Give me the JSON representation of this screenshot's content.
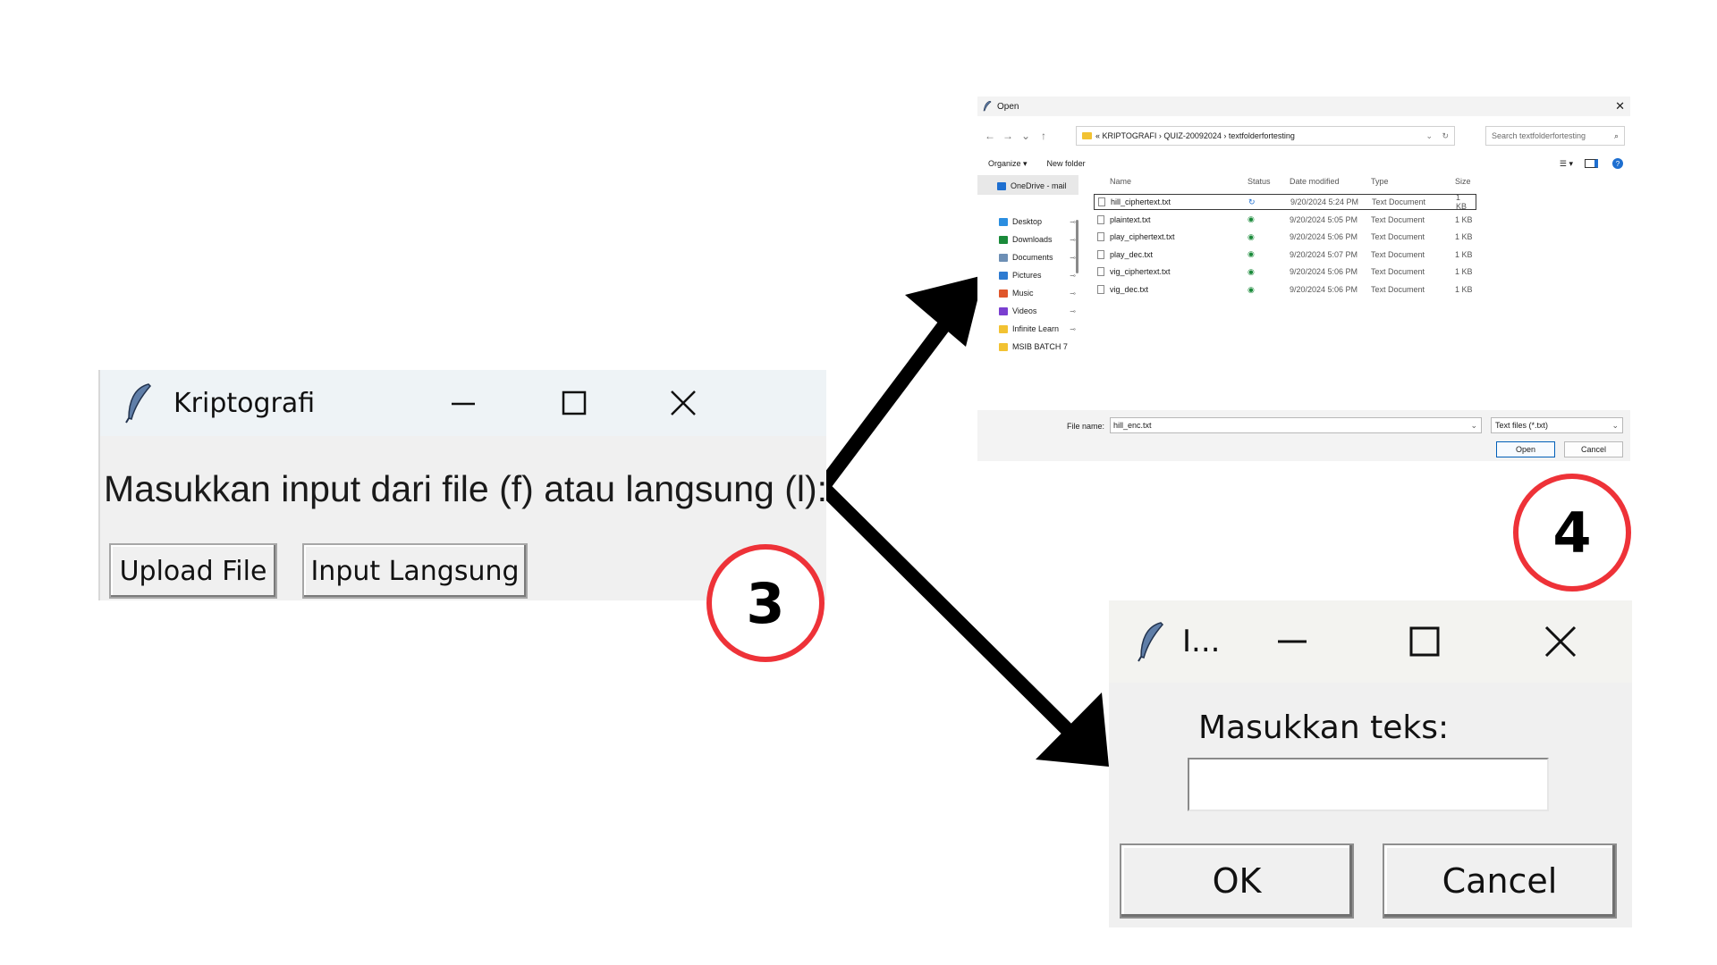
{
  "kriptografi_window": {
    "title": "Kriptografi",
    "prompt": "Masukkan input dari file (f) atau langsung (l):",
    "buttons": {
      "upload": "Upload File",
      "direct": "Input Langsung"
    }
  },
  "open_dialog": {
    "title": "Open",
    "breadcrumb": "« KRIPTOGRAFI  ›  QUIZ-20092024  ›  textfolderfortesting",
    "search_placeholder": "Search textfolderfortesting",
    "toolbar": {
      "organize": "Organize ▾",
      "new_folder": "New folder"
    },
    "sidebar": [
      {
        "label": "OneDrive - mail",
        "color": "#1e6fd0",
        "pinned": false
      },
      {
        "label": "Desktop",
        "color": "#2b8ee0",
        "pinned": true
      },
      {
        "label": "Downloads",
        "color": "#1a8a3a",
        "pinned": true
      },
      {
        "label": "Documents",
        "color": "#6d8fb5",
        "pinned": true
      },
      {
        "label": "Pictures",
        "color": "#2d7bd1",
        "pinned": true
      },
      {
        "label": "Music",
        "color": "#e0562b",
        "pinned": true
      },
      {
        "label": "Videos",
        "color": "#7a3fd0",
        "pinned": true
      },
      {
        "label": "Infinite Learn",
        "color": "#f2c232",
        "pinned": true
      },
      {
        "label": "MSIB BATCH 7",
        "color": "#f2c232",
        "pinned": false
      }
    ],
    "columns": {
      "name": "Name",
      "status": "Status",
      "date": "Date modified",
      "type": "Type",
      "size": "Size"
    },
    "files": [
      {
        "name": "hill_ciphertext.txt",
        "status": "syncing",
        "date": "9/20/2024 5:24 PM",
        "type": "Text Document",
        "size": "1 KB"
      },
      {
        "name": "plaintext.txt",
        "status": "synced",
        "date": "9/20/2024 5:05 PM",
        "type": "Text Document",
        "size": "1 KB"
      },
      {
        "name": "play_ciphertext.txt",
        "status": "synced",
        "date": "9/20/2024 5:06 PM",
        "type": "Text Document",
        "size": "1 KB"
      },
      {
        "name": "play_dec.txt",
        "status": "synced",
        "date": "9/20/2024 5:07 PM",
        "type": "Text Document",
        "size": "1 KB"
      },
      {
        "name": "vig_ciphertext.txt",
        "status": "synced",
        "date": "9/20/2024 5:06 PM",
        "type": "Text Document",
        "size": "1 KB"
      },
      {
        "name": "vig_dec.txt",
        "status": "synced",
        "date": "9/20/2024 5:06 PM",
        "type": "Text Document",
        "size": "1 KB"
      }
    ],
    "file_name_label": "File name:",
    "file_name_value": "hill_enc.txt",
    "file_type": "Text files (*.txt)",
    "open_button": "Open",
    "cancel_button": "Cancel"
  },
  "input_dialog": {
    "title": "I...",
    "label": "Masukkan teks:",
    "entry_value": "",
    "ok_button": "OK",
    "cancel_button": "Cancel"
  },
  "markers": {
    "step3": "3",
    "step4": "4"
  },
  "colors": {
    "marker_ring": "#ee3238",
    "arrow": "#000000",
    "titlebar_tint": "#eef3f6"
  }
}
